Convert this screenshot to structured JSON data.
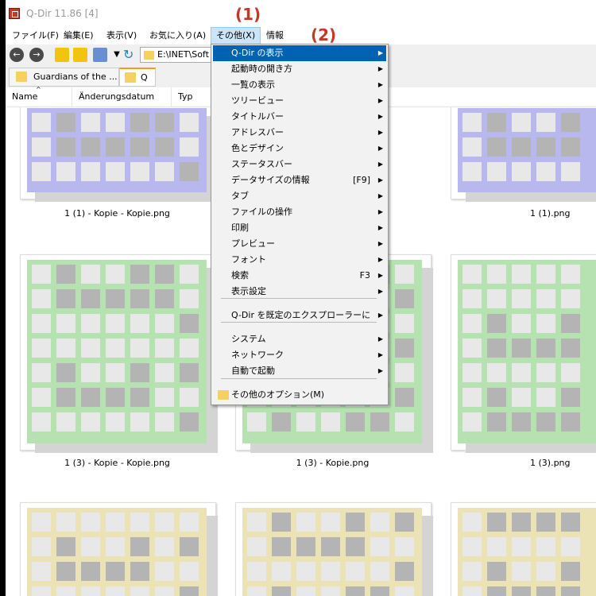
{
  "window": {
    "title": "Q-Dir 11.86 [4]"
  },
  "annotations": {
    "a1": "(1)",
    "a2": "(2)"
  },
  "menubar": {
    "items": [
      {
        "label": "ファイル(F)"
      },
      {
        "label": "編集(E)"
      },
      {
        "label": "表示(V)"
      },
      {
        "label": "お気に入り(A)"
      },
      {
        "label": "その他(X)"
      },
      {
        "label": "情報"
      }
    ]
  },
  "toolbar": {
    "path": "E:\\INET\\Soft"
  },
  "tabs": [
    {
      "label": "Guardians of the ..."
    },
    {
      "label": "Q"
    }
  ],
  "columns": [
    {
      "label": "Name"
    },
    {
      "label": "Änderungsdatum"
    },
    {
      "label": "Typ"
    }
  ],
  "files": [
    {
      "caption": "1 (1) - Kopie - Kopie.png",
      "color": "#b8b8ee"
    },
    {
      "caption": "1 (1).png",
      "color": "#b8b8ee"
    },
    {
      "caption": "1 (3) - Kopie - Kopie.png",
      "color": "#b5e2b0"
    },
    {
      "caption": "1 (3) - Kopie.png",
      "color": "#b5e2b0"
    },
    {
      "caption": "1 (3).png",
      "color": "#b5e2b0"
    },
    {
      "caption": "",
      "color": "#ebe3b5"
    },
    {
      "caption": "",
      "color": "#ebe3b5"
    },
    {
      "caption": "",
      "color": "#ebe3b5"
    }
  ],
  "menu": {
    "items": [
      {
        "label": "Q-Dir の表示",
        "shortcut": "",
        "arrow": "▶",
        "highlight": true
      },
      {
        "label": "起動時の開き方",
        "shortcut": "",
        "arrow": "▶"
      },
      {
        "label": "一覧の表示",
        "shortcut": "",
        "arrow": "▶"
      },
      {
        "label": "ツリービュー",
        "shortcut": "",
        "arrow": "▶"
      },
      {
        "label": "タイトルバー",
        "shortcut": "",
        "arrow": "▶"
      },
      {
        "label": "アドレスバー",
        "shortcut": "",
        "arrow": "▶"
      },
      {
        "label": "色とデザイン",
        "shortcut": "",
        "arrow": "▶"
      },
      {
        "label": "ステータスバー",
        "shortcut": "",
        "arrow": "▶"
      },
      {
        "label": "データサイズの情報",
        "shortcut": "[F9]",
        "arrow": "▶"
      },
      {
        "label": "タブ",
        "shortcut": "",
        "arrow": "▶"
      },
      {
        "label": "ファイルの操作",
        "shortcut": "",
        "arrow": "▶"
      },
      {
        "label": "印刷",
        "shortcut": "",
        "arrow": "▶"
      },
      {
        "label": "プレビュー",
        "shortcut": "",
        "arrow": "▶"
      },
      {
        "label": "フォント",
        "shortcut": "",
        "arrow": "▶"
      },
      {
        "label": "検索",
        "shortcut": "F3",
        "arrow": "▶"
      },
      {
        "label": "表示設定",
        "shortcut": "",
        "arrow": "▶"
      },
      {
        "label": "Q-Dir を既定のエクスプローラーに",
        "shortcut": "",
        "arrow": "▶"
      },
      {
        "label": "システム",
        "shortcut": "",
        "arrow": "▶"
      },
      {
        "label": "ネットワーク",
        "shortcut": "",
        "arrow": "▶"
      },
      {
        "label": "自動で起動",
        "shortcut": "",
        "arrow": "▶"
      },
      {
        "label": "その他のオプション(M)",
        "shortcut": "",
        "arrow": ""
      }
    ]
  }
}
